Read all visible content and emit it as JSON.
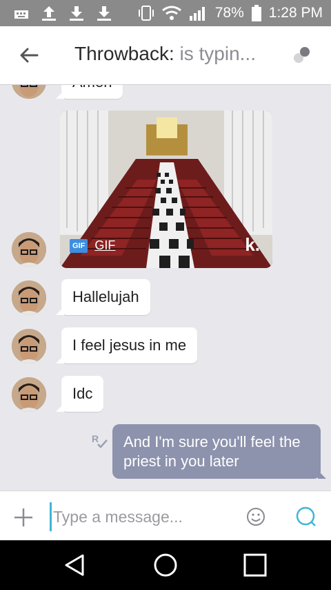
{
  "status_bar": {
    "battery": "78%",
    "time": "1:28 PM"
  },
  "header": {
    "contact_name": "Throwback:",
    "status_text": "is typin..."
  },
  "messages": [
    {
      "sender": "incoming",
      "text": "Amen"
    },
    {
      "sender": "incoming",
      "type": "gif",
      "badge": "GIF",
      "label": "GIF",
      "brand": "k."
    },
    {
      "sender": "incoming",
      "text": "Hallelujah"
    },
    {
      "sender": "incoming",
      "text": "I feel jesus in me"
    },
    {
      "sender": "incoming",
      "text": "Idc"
    },
    {
      "sender": "outgoing",
      "text": "And I'm sure you'll feel the priest in you later",
      "receipt": "R"
    }
  ],
  "composer": {
    "placeholder": "Type a message..."
  },
  "colors": {
    "status_bar_bg": "#8a8a8a",
    "chat_bg": "#e8e8ec",
    "outgoing_bubble": "#8d92ad",
    "accent": "#3fb5d7"
  }
}
